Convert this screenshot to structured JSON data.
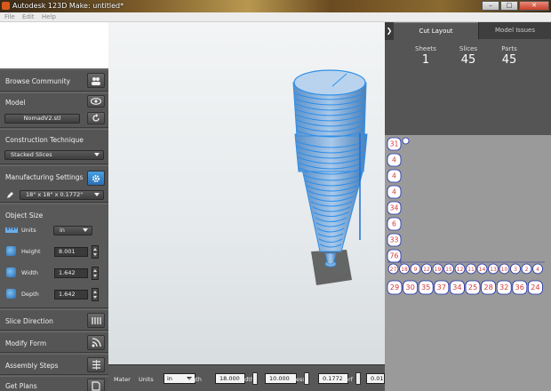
{
  "window": {
    "title": "Autodesk 123D Make: untitled*",
    "buttons": [
      "–",
      "□",
      "✕"
    ]
  },
  "menu": [
    "File",
    "Edit",
    "Help"
  ],
  "left": {
    "browse_community": "Browse Community",
    "model_label": "Model",
    "model_file": "NomadV2.stl",
    "construction_label": "Construction Technique",
    "construction_value": "Stacked Slices",
    "manufacturing_label": "Manufacturing Settings",
    "manufacturing_value": "18\" x 18\" x 0.1772\"",
    "object_size_label": "Object Size",
    "units_label": "Units",
    "units_value": "in",
    "height_label": "Height",
    "height_value": "8.001",
    "width_label": "Width",
    "width_value": "1.642",
    "depth_label": "Depth",
    "depth_value": "1.642",
    "slice_direction": "Slice Direction",
    "modify_form": "Modify Form",
    "assembly_steps": "Assembly Steps",
    "get_plans": "Get Plans"
  },
  "toolbar": {
    "material_label": "Mater",
    "units_label": "Units",
    "units_value": "in",
    "length_label": "ngth",
    "length_value": "18.000",
    "width_label": "Width",
    "width_value": "10.000",
    "thickness_label": "kness",
    "thickness_value": "0.1772",
    "kerf_label": "Kerf",
    "kerf_value": "0.010"
  },
  "right": {
    "tab_cut_layout": "Cut Layout",
    "tab_model_issues": "Model Issues",
    "sheets_label": "Sheets",
    "sheets_value": "1",
    "slices_label": "Slices",
    "slices_value": "45",
    "parts_label": "Parts",
    "parts_value": "45",
    "collapse": "❯"
  },
  "parts_labels": {
    "col": [
      "31",
      "4",
      "4",
      "4",
      "34",
      "6",
      "33",
      "76"
    ],
    "row_small": [
      "27",
      "18",
      "9",
      "12",
      "19",
      "15",
      "12",
      "11",
      "14",
      "13",
      "10",
      "3",
      "2",
      "4"
    ],
    "row_big": [
      "29",
      "30",
      "35",
      "37",
      "34",
      "25",
      "28",
      "32",
      "36",
      "24"
    ]
  },
  "colors": {
    "model_blue": "#2f8fe8",
    "part_red": "#d43c3c",
    "part_outline": "#2233aa",
    "accent_blue": "#3a86d0"
  }
}
